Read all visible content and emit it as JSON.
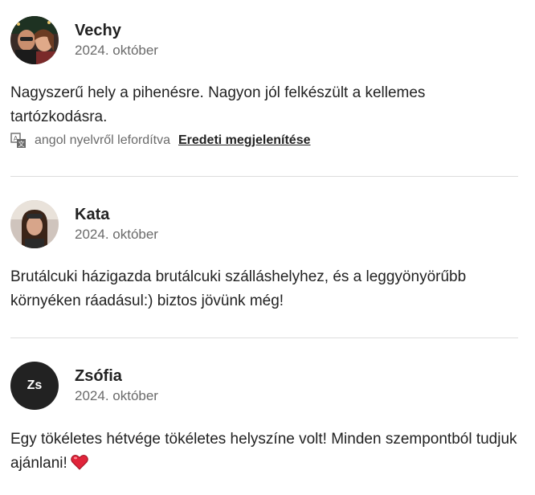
{
  "reviews": [
    {
      "name": "Vechy",
      "date": "2024. október",
      "text": "Nagyszerű hely a pihenésre. Nagyon jól felkészült a kellemes tartózkodásra.",
      "translation_note": "angol nyelvről lefordítva",
      "show_original_label": "Eredeti megjelenítése",
      "avatar": "photo"
    },
    {
      "name": "Kata",
      "date": "2024. október",
      "text": "Brutálcuki házigazda brutálcuki szálláshelyhez, és a leggyönyörűbb környéken ráadásul:) biztos jövünk még!",
      "avatar": "photo"
    },
    {
      "name": "Zsófia",
      "date": "2024. október",
      "initials": "Zs",
      "text": "Egy tökéletes hétvége tökéletes helyszíne volt! Minden szempontból tudjuk ajánlani!",
      "emoji": "heart-icon",
      "avatar": "initials"
    }
  ],
  "colors": {
    "text_primary": "#222222",
    "text_secondary": "#6a6a6a",
    "divider": "#dddddd",
    "heart": "#e0243a"
  }
}
